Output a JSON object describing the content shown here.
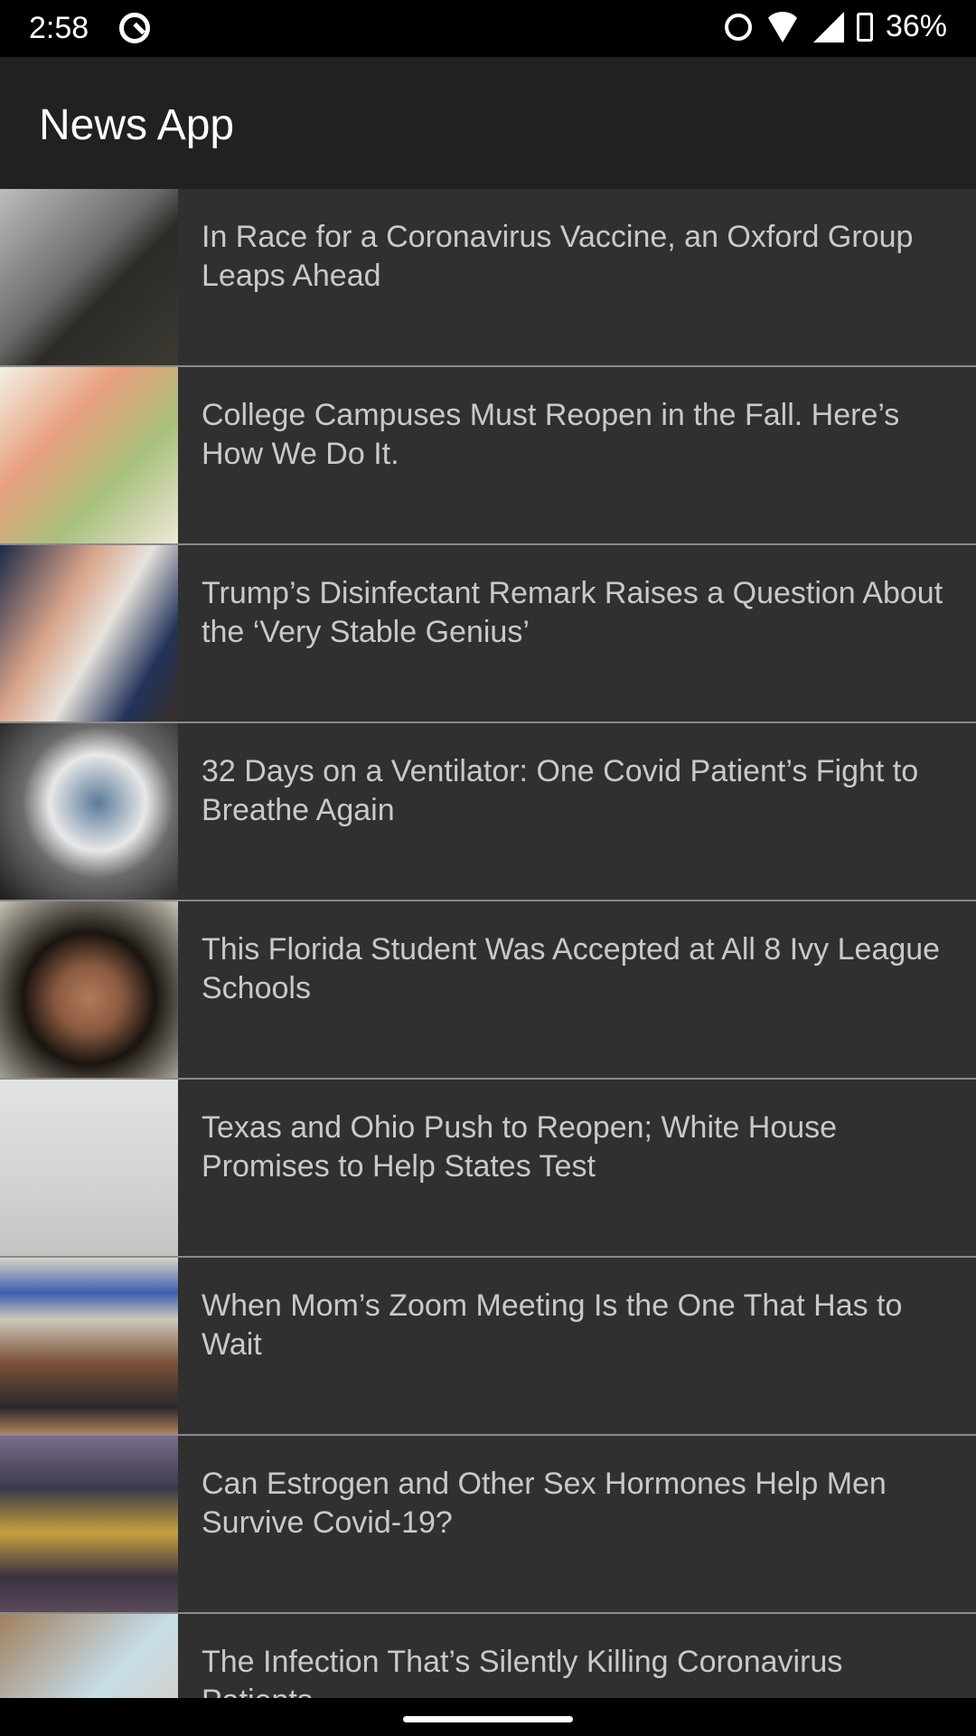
{
  "status_bar": {
    "time": "2:58",
    "battery": "36%"
  },
  "toolbar": {
    "title": "News App"
  },
  "articles": [
    {
      "title": "In Race for a Coronavirus Vaccine, an Oxford Group Leaps Ahead",
      "thumb": "linear-gradient(135deg,#bdbdbd 0%,#6a6a6a 45%,#2b2a26 60%,#3d3a33 100%)"
    },
    {
      "title": "College Campuses Must Reopen in the Fall. Here’s How We Do It.",
      "thumb": "linear-gradient(135deg,#f4efe6 0%,#e7a07d 35%,#a8c07c 65%,#f0e8d8 100%)"
    },
    {
      "title": "Trump’s Disinfectant Remark Raises a Question About the ‘Very Stable Genius’",
      "thumb": "linear-gradient(120deg,#1c2a48 0%,#d9a48a 35%,#e8e3dc 55%,#22335a 80%,#3a2f27 100%)"
    },
    {
      "title": "32 Days on a Ventilator: One Covid Patient’s Fight to Breathe Again",
      "thumb": "radial-gradient(circle at 55% 45%,#5a7a9a 0%,#e8e8e8 35%,#6b6b6b 55%,#1c1c1c 100%)"
    },
    {
      "title": "This Florida Student Was Accepted at All 8 Ivy League Schools",
      "thumb": "radial-gradient(circle at 50% 55%,#b07a5a 0%,#8a5a40 25%,#1a1410 50%,#c8c4b8 100%)"
    },
    {
      "title": "Texas and Ohio Push to Reopen; White House Promises to Help States Test",
      "thumb": "linear-gradient(180deg,#e2e2e2 0%,#d6d6d6 50%,#c4c4c4 100%)"
    },
    {
      "title": "When Mom’s Zoom Meeting Is the One That Has to Wait",
      "thumb": "linear-gradient(180deg,#d9d2c6 0%,#3b5fae 20%,#cfc8bc 35%,#7a5038 60%,#2a2a2a 85%,#b08060 100%)"
    },
    {
      "title": "Can Estrogen and Other Sex Hormones Help Men Survive Covid-19?",
      "thumb": "linear-gradient(180deg,#7c6c8c 0%,#3a3a4a 30%,#c8a040 55%,#3a3040 80%,#5a4a5a 100%)"
    },
    {
      "title": "The Infection That’s Silently Killing Coronavirus Patients",
      "thumb": "linear-gradient(135deg,#a08060 0%,#c8dde8 50%,#d8c4b0 100%)"
    }
  ]
}
